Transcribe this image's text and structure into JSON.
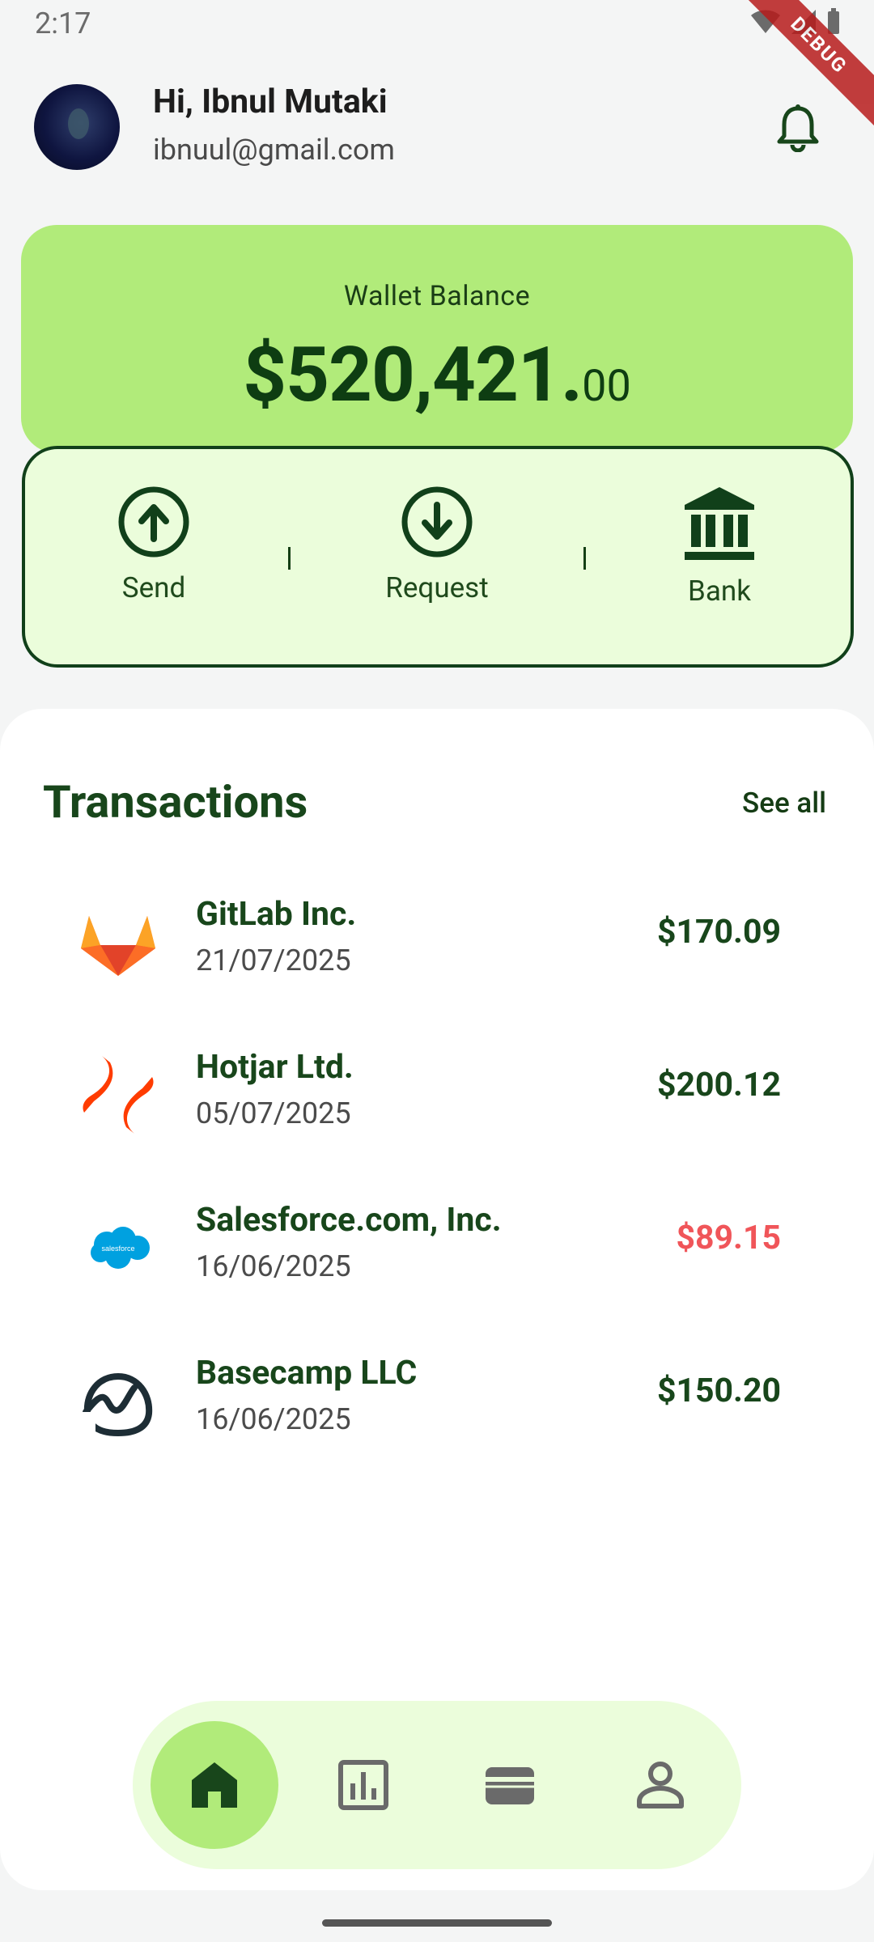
{
  "status_bar": {
    "time": "2:17",
    "debug_label": "DEBUG"
  },
  "header": {
    "greeting": "Hi, Ibnul Mutaki",
    "email": "ibnuul@gmail.com"
  },
  "wallet": {
    "title": "Wallet Balance",
    "balance_main": "$520,421.",
    "balance_cents": "00",
    "actions": [
      {
        "label": "Send",
        "icon": "arrow-up-circle-icon"
      },
      {
        "label": "Request",
        "icon": "arrow-down-circle-icon"
      },
      {
        "label": "Bank",
        "icon": "bank-icon"
      }
    ]
  },
  "transactions": {
    "heading": "Transactions",
    "see_all": "See all",
    "items": [
      {
        "name": "GitLab Inc.",
        "date": "21/07/2025",
        "amount": "$170.09",
        "negative": false,
        "logo": "gitlab-logo"
      },
      {
        "name": "Hotjar Ltd.",
        "date": "05/07/2025",
        "amount": "$200.12",
        "negative": false,
        "logo": "hotjar-logo"
      },
      {
        "name": "Salesforce.com, Inc.",
        "date": "16/06/2025",
        "amount": "$89.15",
        "negative": true,
        "logo": "salesforce-logo"
      },
      {
        "name": "Basecamp LLC",
        "date": "16/06/2025",
        "amount": "$150.20",
        "negative": false,
        "logo": "basecamp-logo"
      }
    ]
  },
  "nav": {
    "items": [
      "home-icon",
      "chart-icon",
      "wallet-icon",
      "profile-icon"
    ],
    "active": "home-icon"
  },
  "colors": {
    "brand_green_dark": "#18461b",
    "card_green": "#b1eb7a",
    "light_green": "#ebfddb",
    "negative_red": "#f05559"
  }
}
